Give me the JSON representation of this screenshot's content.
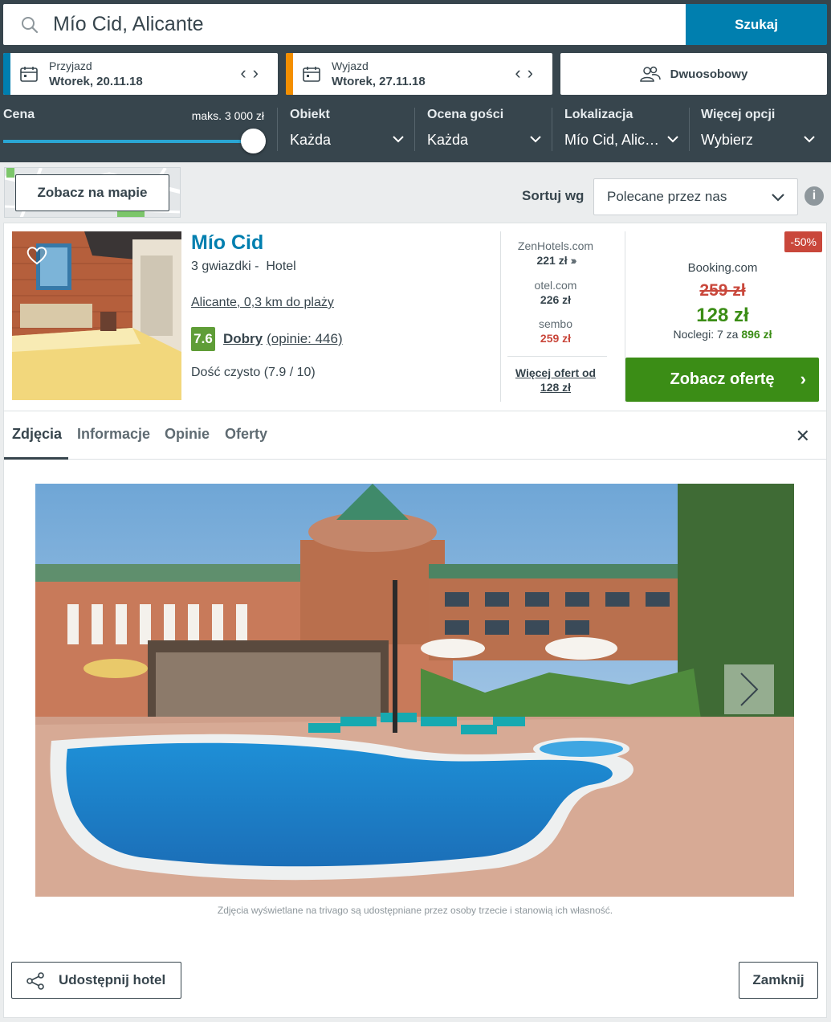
{
  "search": {
    "query": "Mío Cid, Alicante",
    "button_label": "Szukaj"
  },
  "checkin": {
    "label": "Przyjazd",
    "value": "Wtorek, 20.11.18",
    "accent": "#007faf"
  },
  "checkout": {
    "label": "Wyjazd",
    "value": "Wtorek, 27.11.18",
    "accent": "#f48f00"
  },
  "room": {
    "label": "Dwuosobowy"
  },
  "filters": {
    "price": {
      "title": "Cena",
      "max_label": "maks. 3 000 zł",
      "fill_fraction": 1.0
    },
    "property": {
      "title": "Obiekt",
      "value": "Każda"
    },
    "guest_rating": {
      "title": "Ocena gości",
      "value": "Każda"
    },
    "location": {
      "title": "Lokalizacja",
      "value": "Mío Cid, Alic…"
    },
    "more": {
      "title": "Więcej opcji",
      "value": "Wybierz"
    }
  },
  "map_button": "Zobacz na mapie",
  "sort": {
    "label": "Sortuj wg",
    "value": "Polecane przez nas"
  },
  "hotel": {
    "name": "Mío Cid",
    "stars": "3 gwiazdki -",
    "type": "Hotel",
    "location": "Alicante, 0,3 km do plaży",
    "rating": "7.6",
    "rating_word": "Dobry",
    "reviews": "(opinie: 446)",
    "cleanliness": "Dość czysto (7.9 / 10)"
  },
  "deals": [
    {
      "provider": "ZenHotels.com",
      "price": "221 zł"
    },
    {
      "provider": "otel.com",
      "price": "226 zł"
    },
    {
      "provider": "sembo",
      "price": "259 zł"
    }
  ],
  "more_offers": {
    "line1": "Więcej ofert od",
    "line2": "128 zł"
  },
  "best_deal": {
    "discount": "-50%",
    "provider": "Booking.com",
    "old_price": "259 zł",
    "new_price": "128 zł",
    "nights_prefix": "Noclegi: 7 za",
    "nights_total": "896 zł",
    "cta": "Zobacz ofertę"
  },
  "tabs": [
    {
      "label": "Zdjęcia"
    },
    {
      "label": "Informacje"
    },
    {
      "label": "Opinie"
    },
    {
      "label": "Oferty"
    }
  ],
  "caption": "Zdjęcia wyświetlane na trivago są udostępniane przez osoby trzecie i stanowią ich własność.",
  "share_button": "Udostępnij hotel",
  "close_button": "Zamknij",
  "colors": {
    "header_bg": "#37454d",
    "brand_blue": "#007faf",
    "green": "#3b8d16",
    "red": "#c9473b"
  }
}
